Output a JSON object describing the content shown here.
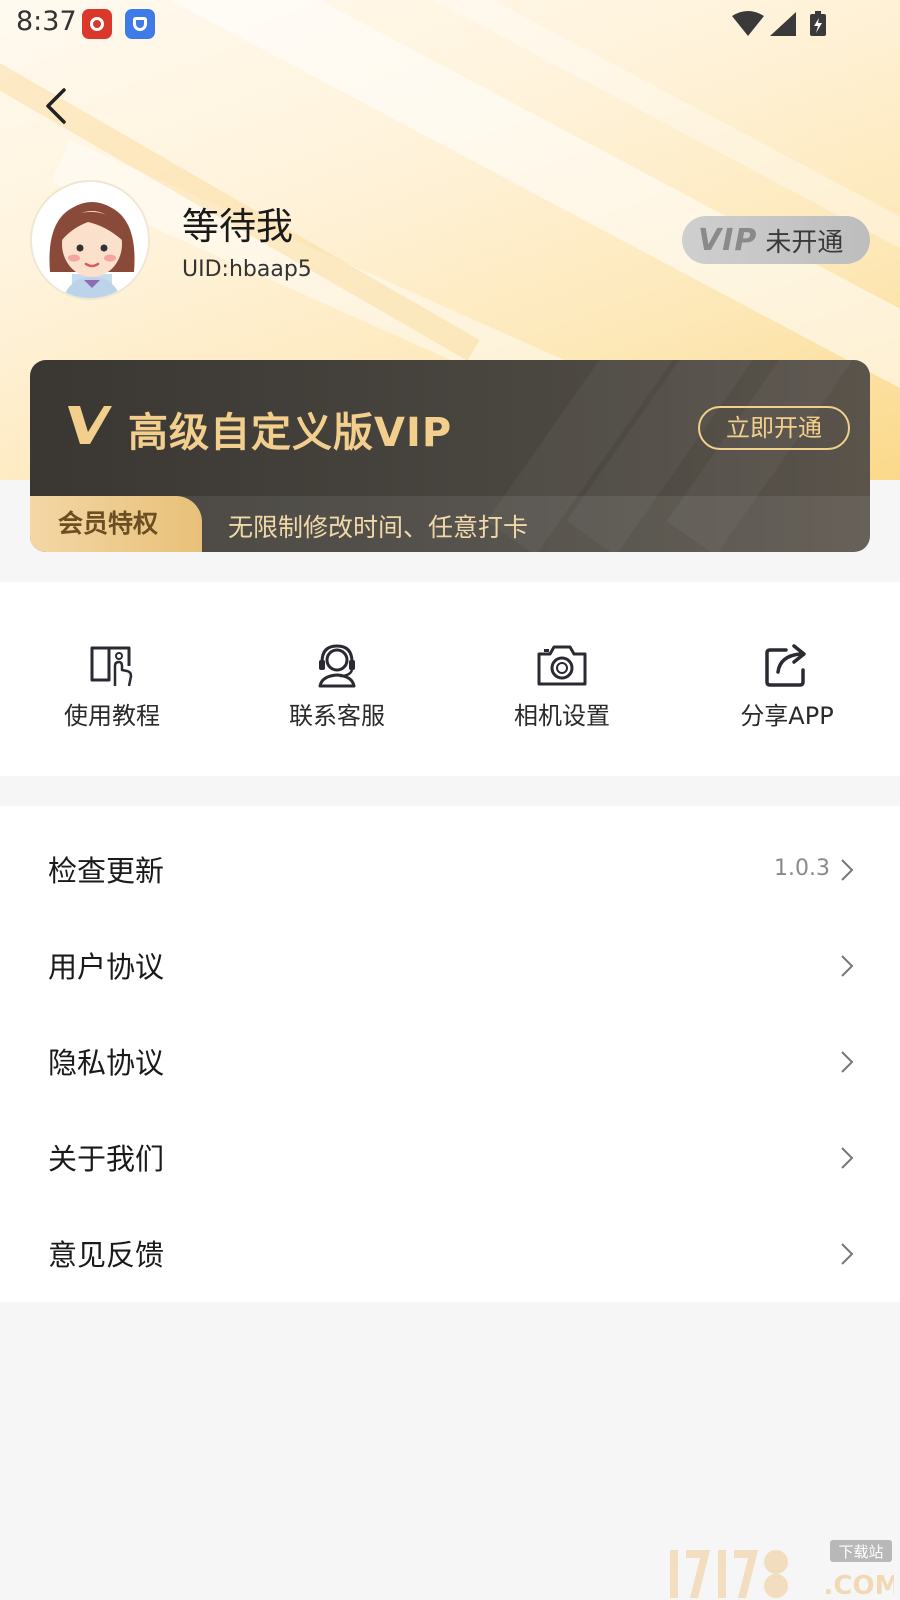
{
  "status_bar": {
    "time": "8:37"
  },
  "profile": {
    "name": "等待我",
    "uid": "UID:hbaap5",
    "vip_mark": "VIP",
    "vip_status": "未开通"
  },
  "vip_card": {
    "title": "高级自定义版VIP",
    "open_button": "立即开通",
    "privilege_tag": "会员特权",
    "privilege_text": "无限制修改时间、任意打卡"
  },
  "quick_actions": [
    {
      "label": "使用教程",
      "icon": "tutorial-book-icon"
    },
    {
      "label": "联系客服",
      "icon": "headset-icon"
    },
    {
      "label": "相机设置",
      "icon": "camera-icon"
    },
    {
      "label": "分享APP",
      "icon": "share-icon"
    }
  ],
  "menu": [
    {
      "label": "检查更新",
      "value": "1.0.3"
    },
    {
      "label": "用户协议",
      "value": ""
    },
    {
      "label": "隐私协议",
      "value": ""
    },
    {
      "label": "关于我们",
      "value": ""
    },
    {
      "label": "意见反馈",
      "value": ""
    }
  ],
  "colors": {
    "vip_gold": "#f2cf8c",
    "card_dark": "#3a3733",
    "page_bg": "#f6f6f7"
  }
}
